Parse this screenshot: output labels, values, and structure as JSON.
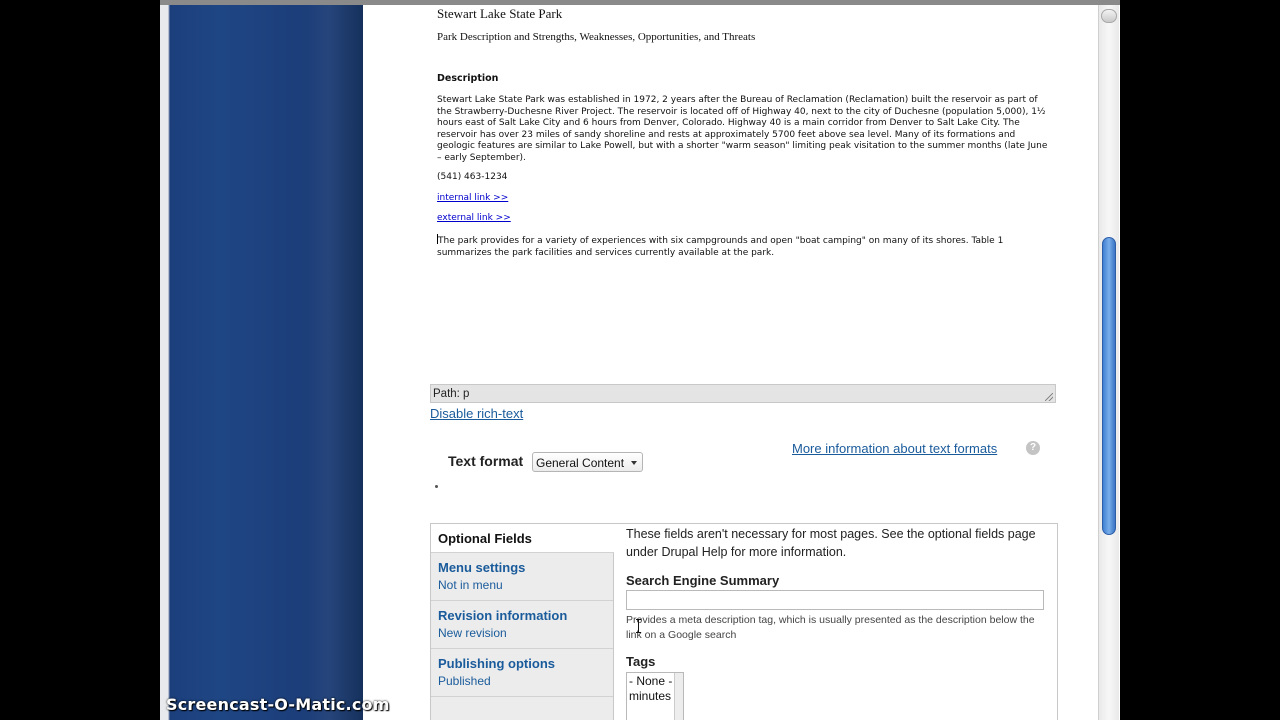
{
  "editor": {
    "doc_title": "Stewart Lake State Park",
    "doc_subtitle": "Park Description and Strengths, Weaknesses, Opportunities, and Threats",
    "section_heading": "Description",
    "paragraph_1": "Stewart Lake State Park was established in 1972, 2 years after the Bureau of Reclamation (Reclamation) built the reservoir as part of the Strawberry-Duchesne River Project.  The reservoir is located off of Highway 40, next to the city of Duchesne (population 5,000), 1½ hours east of Salt Lake City and 6 hours from Denver, Colorado.  Highway 40 is a main corridor from Denver to Salt Lake City.  The reservoir has over 23 miles of sandy shoreline and rests at approximately 5700 feet above sea level.  Many of its formations and geologic features are similar to Lake Powell, but with a shorter \"warm season\" limiting peak visitation to the summer months (late June – early September).",
    "phone": "(541) 463-1234",
    "internal_link": "internal link >>",
    "external_link": "external link >>",
    "paragraph_2": "The park provides for a variety of experiences with six campgrounds and open \"boat camping\" on many of its shores.  Table 1 summarizes the park facilities and services currently available at the park."
  },
  "path_bar": "Path: p",
  "disable_rich_text": "Disable rich-text",
  "text_format": {
    "label": "Text format",
    "selected": "General Content",
    "more_info": "More information about text formats",
    "help_icon": "?"
  },
  "optional_fields": {
    "title": "Optional Fields",
    "tabs": [
      {
        "title": "Menu settings",
        "summary": "Not in menu"
      },
      {
        "title": "Revision information",
        "summary": "New revision"
      },
      {
        "title": "Publishing options",
        "summary": "Published"
      }
    ],
    "intro": "These fields aren't necessary for most pages. See the optional fields page under Drupal Help for more information.",
    "search_engine_summary": {
      "label": "Search Engine Summary",
      "value": "",
      "description": "Provides a meta description tag, which is usually presented as the description below the link on a Google search"
    },
    "tags": {
      "label": "Tags",
      "options": [
        "- None -",
        "minutes"
      ]
    }
  },
  "watermark": "Screencast-O-Matic.com",
  "colors": {
    "link": "#1a5b9b",
    "sidebar_blue": "#1f4684",
    "scroll_thumb": "#4f8ad9"
  }
}
